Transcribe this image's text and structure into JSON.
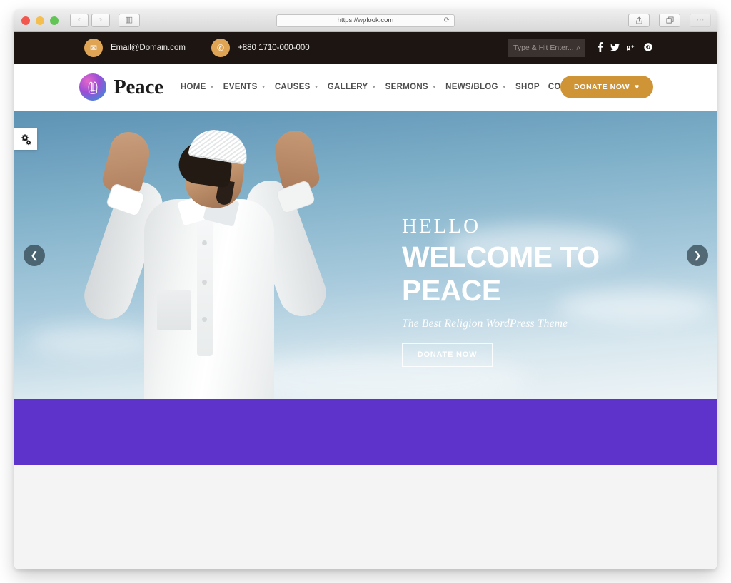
{
  "browser": {
    "url": "https://wplook.com",
    "reload_icon": "reload-icon",
    "back_icon": "‹",
    "forward_icon": "›",
    "sidebar_icon": "▥",
    "share_icon": "share-icon",
    "tabs_icon": "tabs-icon",
    "traffic_lights": [
      "close",
      "minimize",
      "maximize"
    ]
  },
  "topbar": {
    "email_icon": "✉",
    "email": "Email@Domain.com",
    "phone_icon": "✆",
    "phone": "+880 1710-000-000",
    "search_placeholder": "Type & Hit Enter...",
    "search_value": "",
    "search_icon": "⌕",
    "socials": [
      {
        "name": "facebook",
        "glyph": "f"
      },
      {
        "name": "twitter",
        "glyph": "🐦"
      },
      {
        "name": "google-plus",
        "glyph": "g+"
      },
      {
        "name": "pinterest",
        "glyph": "P"
      }
    ],
    "bg_color": "#1c1511",
    "accent_color": "#dfa554"
  },
  "header": {
    "logo_text": "Peace",
    "nav": [
      {
        "label": "HOME",
        "has_dropdown": true
      },
      {
        "label": "EVENTS",
        "has_dropdown": true
      },
      {
        "label": "CAUSES",
        "has_dropdown": true
      },
      {
        "label": "GALLERY",
        "has_dropdown": true
      },
      {
        "label": "SERMONS",
        "has_dropdown": true
      },
      {
        "label": "NEWS/BLOG",
        "has_dropdown": true
      },
      {
        "label": "SHOP",
        "has_dropdown": false
      },
      {
        "label": "CONTACT US",
        "has_dropdown": false
      }
    ],
    "donate_label": "DONATE NOW",
    "donate_icon": "♥",
    "donate_color": "#cf9436"
  },
  "hero": {
    "eyebrow": "HELLO",
    "title_line1": "WELCOME TO",
    "title_line2": "PEACE",
    "subtitle": "The Best Religion WordPress Theme",
    "cta_label": "DONATE NOW",
    "prev_icon": "❮",
    "next_icon": "❯",
    "image_alt": "Man in white kurta and taqiyah praying with raised hands against blue sky"
  },
  "sidebar_tab": {
    "icon": "gears-icon"
  },
  "sections": {
    "band_color": "#5e33cc",
    "gray_color": "#f4f4f4"
  }
}
